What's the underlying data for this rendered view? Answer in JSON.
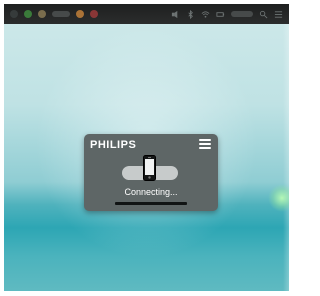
{
  "screen": {
    "background": "#2da6b4"
  },
  "widget": {
    "brand": "PHILIPS",
    "menu_icon": "hamburger-menu-icon",
    "device_icon": "smartphone-icon",
    "status_text": "Connecting...",
    "background": "#5e6666",
    "toggle_color": "#c7cbcb"
  }
}
